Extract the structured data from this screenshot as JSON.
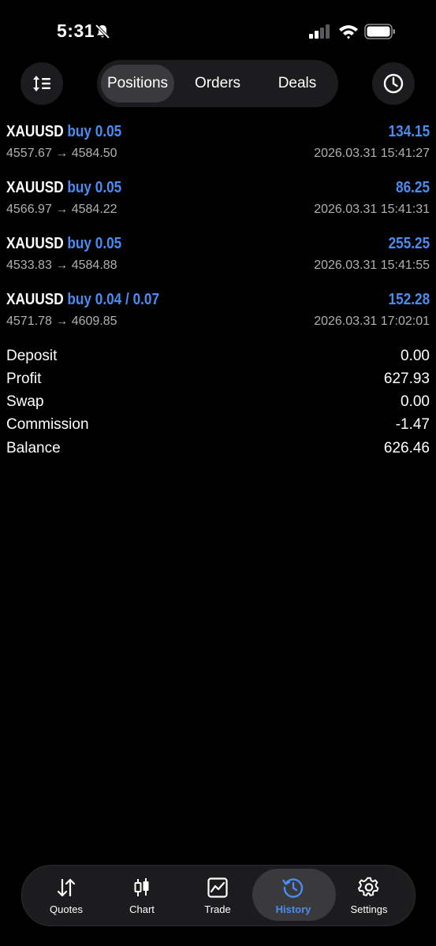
{
  "status": {
    "time": "5:31"
  },
  "toolbar": {
    "segments": [
      {
        "label": "Positions"
      },
      {
        "label": "Orders"
      },
      {
        "label": "Deals"
      }
    ]
  },
  "deals": [
    {
      "symbol": "XAUUSD",
      "direction": "buy 0.05",
      "profit": "134.15",
      "prices": "4557.67 → 4584.50",
      "time": "2026.03.31 15:41:27"
    },
    {
      "symbol": "XAUUSD",
      "direction": "buy 0.05",
      "profit": "86.25",
      "prices": "4566.97 → 4584.22",
      "time": "2026.03.31 15:41:31"
    },
    {
      "symbol": "XAUUSD",
      "direction": "buy 0.05",
      "profit": "255.25",
      "prices": "4533.83 → 4584.88",
      "time": "2026.03.31 15:41:55"
    },
    {
      "symbol": "XAUUSD",
      "direction": "buy 0.04 / 0.07",
      "profit": "152.28",
      "prices": "4571.78 → 4609.85",
      "time": "2026.03.31 17:02:01"
    }
  ],
  "summary": [
    {
      "label": "Deposit",
      "value": "0.00"
    },
    {
      "label": "Profit",
      "value": "627.93"
    },
    {
      "label": "Swap",
      "value": "0.00"
    },
    {
      "label": "Commission",
      "value": "-1.47"
    },
    {
      "label": "Balance",
      "value": "626.46"
    }
  ],
  "tabs": [
    {
      "label": "Quotes",
      "icon": "quotes-icon"
    },
    {
      "label": "Chart",
      "icon": "candlestick-icon"
    },
    {
      "label": "Trade",
      "icon": "trade-chart-icon"
    },
    {
      "label": "History",
      "icon": "history-icon"
    },
    {
      "label": "Settings",
      "icon": "gear-icon"
    }
  ],
  "colors": {
    "accent": "#4a8cf0",
    "background": "#000000",
    "surface": "#1c1c1e"
  }
}
